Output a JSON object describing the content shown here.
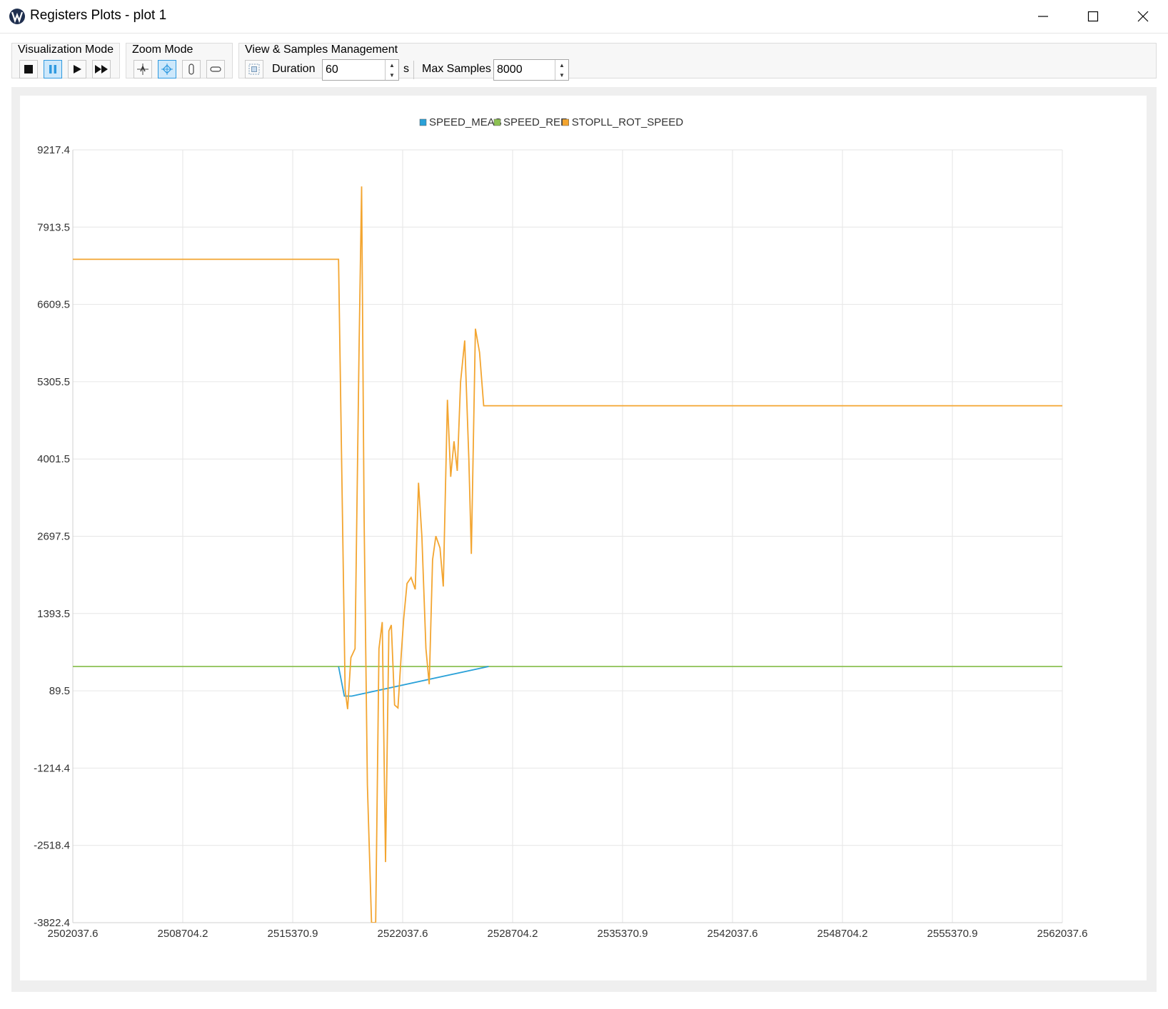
{
  "window": {
    "title": "Registers Plots - plot 1"
  },
  "toolbar": {
    "visualization_mode": {
      "label": "Visualization Mode",
      "buttons": [
        "stop-icon",
        "pause-icon",
        "play-icon",
        "fast-forward-icon"
      ],
      "active": "pause-icon"
    },
    "zoom_mode": {
      "label": "Zoom Mode",
      "buttons": [
        "zoom-xy-icon",
        "zoom-rect-icon",
        "zoom-vertical-icon",
        "zoom-horizontal-icon"
      ],
      "active": "zoom-rect-icon"
    },
    "view_samples": {
      "label": "View & Samples Management",
      "duration_label": "Duration",
      "duration_value": "60",
      "duration_unit": "s",
      "max_samples_label": "Max Samples",
      "max_samples_value": "8000"
    }
  },
  "chart_data": {
    "type": "line",
    "legend_position": "top-center",
    "grid": true,
    "xlim": [
      2502037.6,
      2562037.6
    ],
    "ylim": [
      -3822.4,
      9217.4
    ],
    "x_ticks": [
      "2502037.6",
      "2508704.2",
      "2515370.9",
      "2522037.6",
      "2528704.2",
      "2535370.9",
      "2542037.6",
      "2548704.2",
      "2555370.9",
      "2562037.6"
    ],
    "y_ticks": [
      "9217.4",
      "7913.5",
      "6609.5",
      "5305.5",
      "4001.5",
      "2697.5",
      "1393.5",
      "89.5",
      "-1214.4",
      "-2518.4",
      "-3822.4"
    ],
    "series": [
      {
        "name": "SPEED_MEAS",
        "color": "#2aa1d8",
        "x": [
          2518150,
          2518500,
          2518950,
          2527250
        ],
        "y": [
          500,
          0,
          0,
          500
        ]
      },
      {
        "name": "SPEED_REF",
        "color": "#8cc152",
        "x": [
          2502037.6,
          2562037.6
        ],
        "y": [
          500,
          500
        ]
      },
      {
        "name": "STOPLL_ROT_SPEED",
        "color": "#f3a530",
        "x": [
          2502037.6,
          2518150,
          2518550,
          2518700,
          2518900,
          2519150,
          2519400,
          2519550,
          2519700,
          2519900,
          2520150,
          2520400,
          2520600,
          2520800,
          2521000,
          2521200,
          2521350,
          2521550,
          2521750,
          2521950,
          2522100,
          2522300,
          2522550,
          2522800,
          2523000,
          2523200,
          2523450,
          2523650,
          2523850,
          2524050,
          2524300,
          2524500,
          2524750,
          2524950,
          2525150,
          2525350,
          2525550,
          2525800,
          2526050,
          2526200,
          2526450,
          2526700,
          2526950,
          2527200,
          2562037.6
        ],
        "y": [
          7370,
          7370,
          100,
          -220,
          650,
          800,
          6000,
          8600,
          3000,
          -1500,
          -3822.4,
          -3822.4,
          800,
          1250,
          -2800,
          1100,
          1200,
          -150,
          -200,
          700,
          1300,
          1900,
          2000,
          1800,
          3600,
          2700,
          800,
          200,
          2300,
          2700,
          2500,
          1850,
          5000,
          3700,
          4300,
          3800,
          5300,
          6000,
          4000,
          2400,
          6200,
          5800,
          4900,
          4900,
          4900
        ]
      }
    ]
  }
}
